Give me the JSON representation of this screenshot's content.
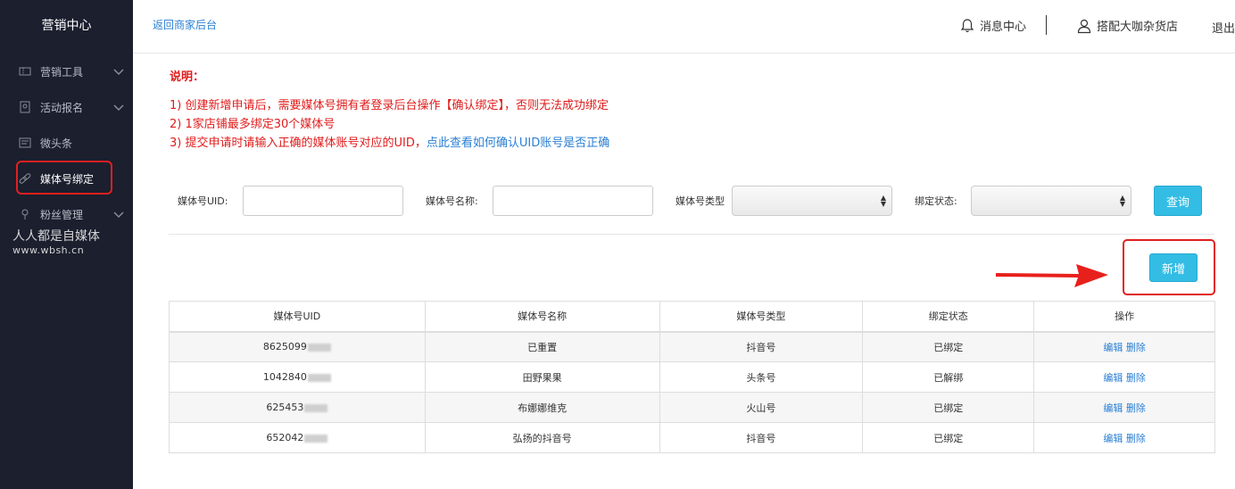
{
  "sidebar": {
    "title": "营销中心",
    "items": [
      {
        "label": "营销工具",
        "icon": "ticket-icon",
        "expandable": true
      },
      {
        "label": "活动报名",
        "icon": "badge-icon",
        "expandable": true
      },
      {
        "label": "微头条",
        "icon": "message-icon",
        "expandable": false
      },
      {
        "label": "媒体号绑定",
        "icon": "link-icon",
        "expandable": false,
        "active": true
      },
      {
        "label": "粉丝管理",
        "icon": "flower-icon",
        "expandable": true
      }
    ],
    "watermark_line1": "人人都是自媒体",
    "watermark_line2": "www.wbsh.cn"
  },
  "topbar": {
    "back_link": "返回商家后台",
    "messages": "消息中心",
    "store_name": "搭配大咖杂货店",
    "logout": "退出"
  },
  "notes": {
    "title": "说明：",
    "line1": "1) 创建新增申请后，需要媒体号拥有者登录后台操作【确认绑定】，否则无法成功绑定",
    "line2": "2) 1家店铺最多绑定30个媒体号",
    "line3": "3) 提交申请时请输入正确的媒体账号对应的UID，",
    "line3_link": "点此查看如何确认UID账号是否正确"
  },
  "filters": {
    "uid_label": "媒体号UID:",
    "name_label": "媒体号名称:",
    "type_label": "媒体号类型",
    "status_label": "绑定状态:",
    "query_button": "查询"
  },
  "add_button": "新增",
  "table": {
    "headers": [
      "媒体号UID",
      "媒体号名称",
      "媒体号类型",
      "绑定状态",
      "操作"
    ],
    "rows": [
      {
        "uid": "8625099",
        "name": "已重置",
        "type": "抖音号",
        "status": "已绑定"
      },
      {
        "uid": "1042840",
        "name": "田野果果",
        "type": "头条号",
        "status": "已解绑"
      },
      {
        "uid": "625453",
        "name": "布娜娜维克",
        "type": "火山号",
        "status": "已绑定"
      },
      {
        "uid": "652042",
        "name": "弘扬的抖音号",
        "type": "抖音号",
        "status": "已绑定"
      }
    ],
    "edit_label": "编辑",
    "delete_label": "删除"
  },
  "colors": {
    "accent": "#33bde4",
    "sidebar_bg": "#1b1f2e",
    "highlight": "#e02020",
    "note_red": "#e01b1b",
    "link": "#2a7fd4"
  }
}
